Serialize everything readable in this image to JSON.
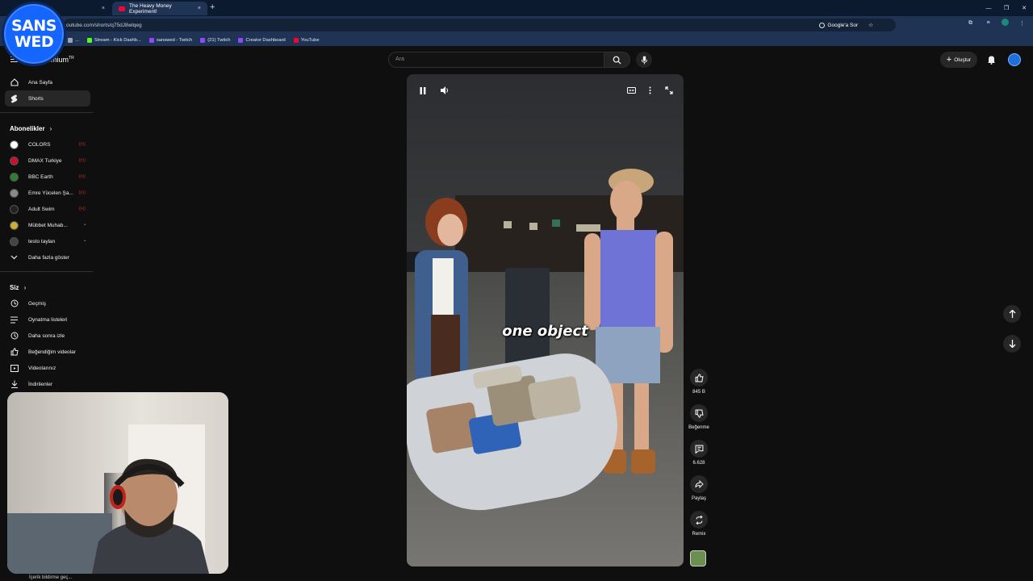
{
  "browser": {
    "inactive_tab_title": "",
    "active_tab_title": "The Heavy Money Experiment!",
    "close_glyph": "×",
    "new_tab_glyph": "+",
    "url": "outube.com/shorts/q75dJ8wlqeg",
    "google_search_label": "Google'a Sor",
    "bookmarks": [
      {
        "label": "...",
        "color": "#9aa5b4"
      },
      {
        "label": "Stream - Kick Dashb...",
        "color": "#53fc18"
      },
      {
        "label": "sanswed - Twitch",
        "color": "#9146ff"
      },
      {
        "label": "(21) Twitch",
        "color": "#9146ff"
      },
      {
        "label": "Creator Dashboard",
        "color": "#9146ff"
      },
      {
        "label": "YouTube",
        "color": "#ff0033"
      }
    ]
  },
  "overlay_badge": {
    "line1": "SANS",
    "line2": "WED"
  },
  "youtube": {
    "logo_text": "emium",
    "logo_sup": "TR",
    "search_placeholder": "Ara",
    "create_label": "Oluştur",
    "sidebar": {
      "main": [
        {
          "label": "Ana Sayfa",
          "icon": "home-icon"
        },
        {
          "label": "Shorts",
          "icon": "shorts-icon",
          "active": true
        }
      ],
      "subscriptions_header": "Abonelikler",
      "subscriptions": [
        {
          "label": "COLORS",
          "avatar_color": "#ffffff",
          "live": true
        },
        {
          "label": "DMAX Turkiye",
          "avatar_color": "#c8102e",
          "live": true
        },
        {
          "label": "BBC Earth",
          "avatar_color": "#2e7d32",
          "live": true
        },
        {
          "label": "Emre Yücelen Şa...",
          "avatar_color": "#8a8a8a",
          "live": true
        },
        {
          "label": "Adult Swim",
          "avatar_color": "#222222",
          "live": true
        },
        {
          "label": "Mübbet Muhab...",
          "avatar_color": "#c9b037",
          "live": false
        },
        {
          "label": "testo taylan",
          "avatar_color": "#444444",
          "live": false
        }
      ],
      "show_more": "Daha fazla göster",
      "you_header": "Siz",
      "you_items": [
        {
          "label": "Geçmiş",
          "icon": "history-icon"
        },
        {
          "label": "Oynatma listeleri",
          "icon": "playlist-icon"
        },
        {
          "label": "Daha sonra izle",
          "icon": "watch-later-icon"
        },
        {
          "label": "Beğendiğim videolar",
          "icon": "liked-icon"
        },
        {
          "label": "Videolarınız",
          "icon": "your-videos-icon"
        },
        {
          "label": "İndirilenler",
          "icon": "download-icon"
        }
      ],
      "footer_partial": "İçerik bildirme geç..."
    },
    "short": {
      "caption": "one object",
      "actions": [
        {
          "name": "like",
          "label": "845 B"
        },
        {
          "name": "dislike",
          "label": "Beğenme"
        },
        {
          "name": "comments",
          "label": "6.628"
        },
        {
          "name": "share",
          "label": "Paylaş"
        },
        {
          "name": "remix",
          "label": "Remix"
        }
      ]
    }
  }
}
